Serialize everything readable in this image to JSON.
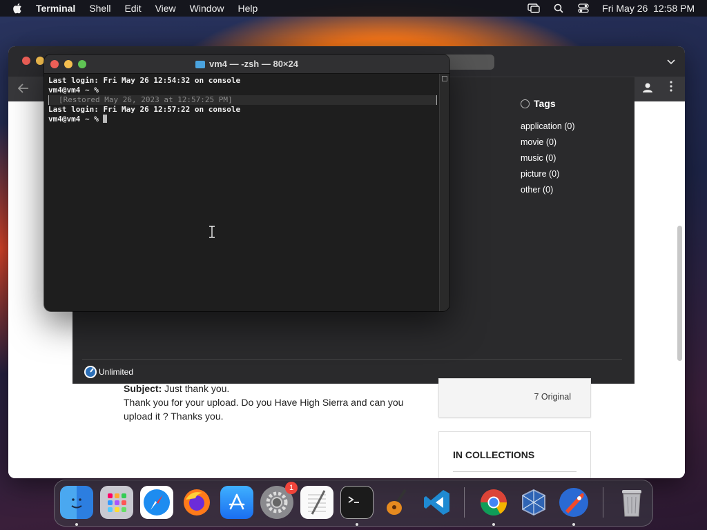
{
  "menubar": {
    "app_name": "Terminal",
    "items": [
      "Shell",
      "Edit",
      "View",
      "Window",
      "Help"
    ],
    "clock": "Fri May 26  12:58 PM"
  },
  "terminal": {
    "title": "vm4 — -zsh — 80×24",
    "lines": {
      "line1": "Last login: Fri May 26 12:54:32 on console",
      "line2": "vm4@vm4 ~ %",
      "restored": "[Restored May 26, 2023 at 12:57:25 PM]",
      "line4": "Last login: Fri May 26 12:57:22 on console",
      "prompt": "vm4@vm4 ~ %"
    }
  },
  "panel": {
    "tags_heading": "Tags",
    "tags": [
      "application (0)",
      "movie (0)",
      "music (0)",
      "picture (0)",
      "other (0)"
    ],
    "unlimited_label": "Unlimited"
  },
  "post": {
    "subject_label": "Subject:",
    "subject_text": "Just thank you.",
    "body": "Thank you for your upload. Do you Have High Sierra and can you upload it ? Thanks you."
  },
  "sidebar_cards": {
    "original_count": "7 Original",
    "collections_title": "IN COLLECTIONS"
  },
  "dock": {
    "items": [
      "Finder",
      "Launchpad",
      "Safari",
      "Firefox",
      "App Store",
      "System Preferences",
      "TextEdit",
      "Terminal",
      "GarageBand",
      "Visual Studio Code",
      "Google Chrome",
      "VirtualBox",
      "Rocket Typist",
      "Trash"
    ],
    "system_prefs_badge": "1"
  }
}
